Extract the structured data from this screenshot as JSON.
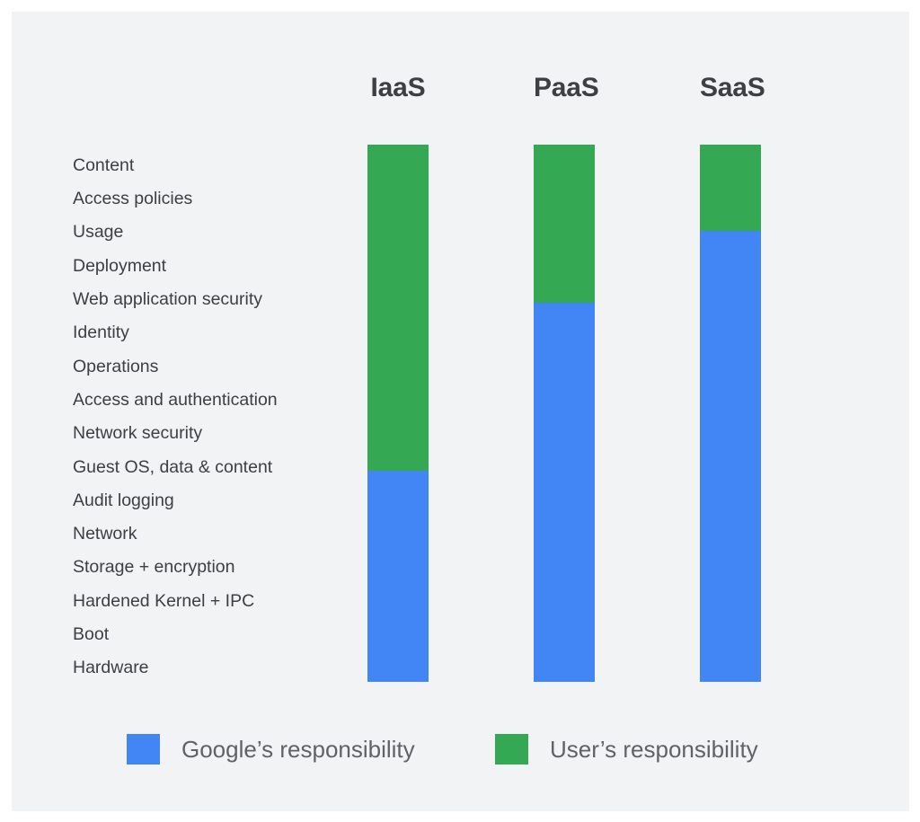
{
  "chart_data": {
    "type": "bar",
    "title": "",
    "subtitle": "",
    "xlabel": "",
    "ylabel": "",
    "orientation": "vertical",
    "stacked": true,
    "grid": false,
    "legend_position": "bottom",
    "categories": [
      "IaaS",
      "PaaS",
      "SaaS"
    ],
    "series": [
      {
        "name": "Google's responsibility",
        "color": "#4285F4",
        "values": [
          39.3,
          70.6,
          84.0
        ]
      },
      {
        "name": "User's responsibility",
        "color": "#34A853",
        "values": [
          60.7,
          29.4,
          16.0
        ]
      }
    ],
    "value_unit": "percent of stack height",
    "ylim": [
      0,
      100
    ],
    "responsibility_rows": [
      "Content",
      "Access policies",
      "Usage",
      "Deployment",
      "Web application security",
      "Identity",
      "Operations",
      "Access and authentication",
      "Network security",
      "Guest OS, data & content",
      "Audit logging",
      "Network",
      "Storage + encryption",
      "Hardened Kernel + IPC",
      "Boot",
      "Hardware"
    ]
  },
  "columns": [
    {
      "label": "IaaS",
      "green_pct": 60.7,
      "blue_pct": 39.3
    },
    {
      "label": "PaaS",
      "green_pct": 29.4,
      "blue_pct": 70.6
    },
    {
      "label": "SaaS",
      "green_pct": 16.0,
      "blue_pct": 84.0
    }
  ],
  "rows": [
    {
      "label": "Content"
    },
    {
      "label": "Access policies"
    },
    {
      "label": "Usage"
    },
    {
      "label": "Deployment"
    },
    {
      "label": "Web application security"
    },
    {
      "label": "Identity"
    },
    {
      "label": "Operations"
    },
    {
      "label": "Access and authentication"
    },
    {
      "label": "Network security"
    },
    {
      "label": "Guest OS, data & content"
    },
    {
      "label": "Audit logging"
    },
    {
      "label": "Network"
    },
    {
      "label": "Storage + encryption"
    },
    {
      "label": "Hardened Kernel + IPC"
    },
    {
      "label": "Boot"
    },
    {
      "label": "Hardware"
    }
  ],
  "legend": {
    "items": [
      {
        "label": "Google’s responsibility",
        "color": "#4285F4",
        "swatch_name": "legend-swatch-google"
      },
      {
        "label": "User’s responsibility",
        "color": "#34A853",
        "swatch_name": "legend-swatch-user"
      }
    ]
  },
  "colors": {
    "google_blue": "#4285F4",
    "user_green": "#34A853",
    "panel_background": "#F1F3F4",
    "page_background": "#FFFFFF",
    "header_text": "#3C4043",
    "label_text": "#3C4043",
    "legend_text": "#5F6368"
  }
}
